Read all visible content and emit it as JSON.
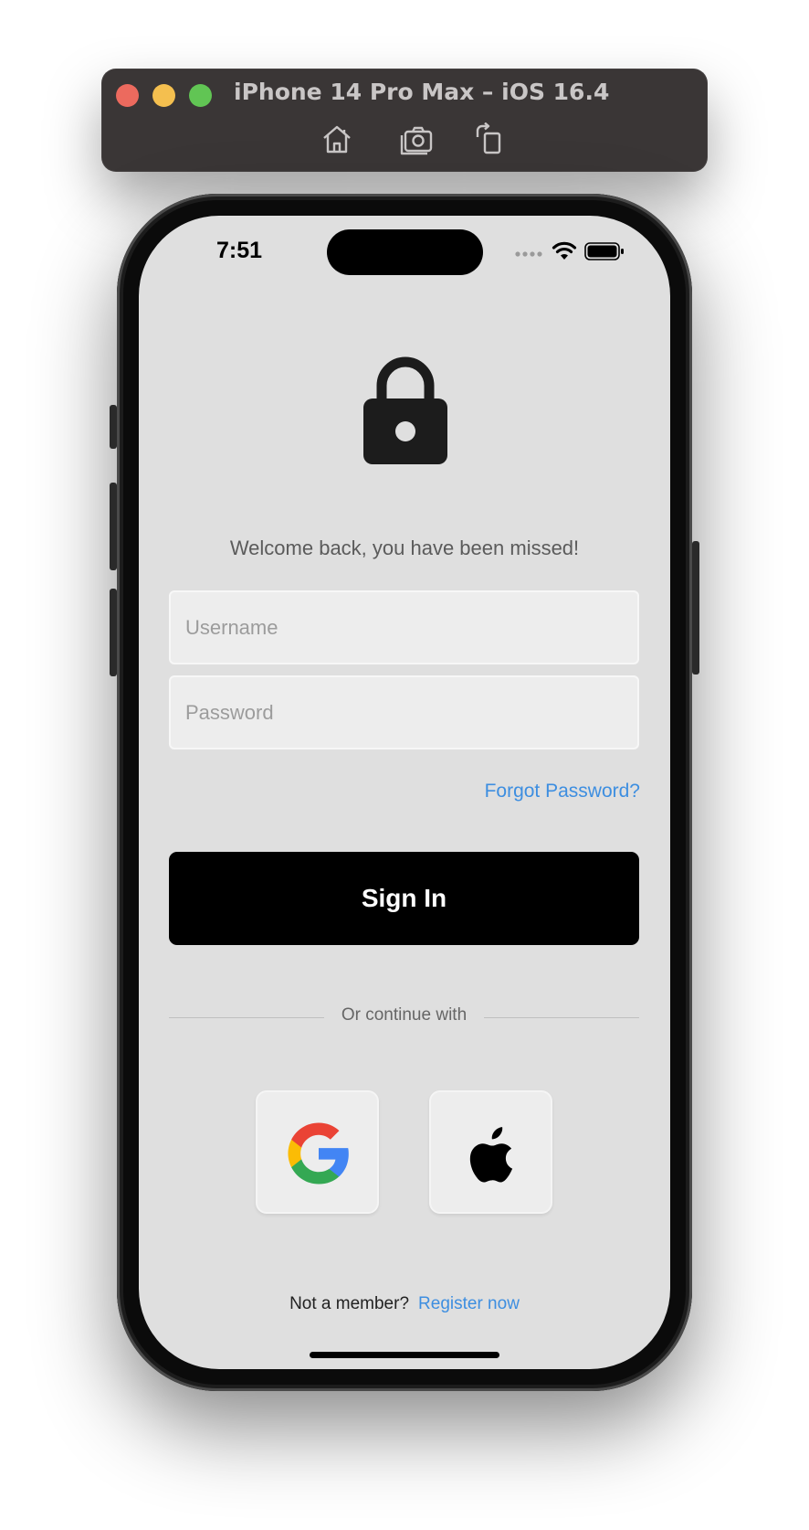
{
  "simulator": {
    "title": "iPhone 14 Pro Max – iOS 16.4",
    "buttons": [
      "home-icon",
      "screenshot-icon",
      "rotate-icon"
    ]
  },
  "status_bar": {
    "time": "7:51",
    "icons": [
      "cellular-signal-icon",
      "wifi-icon",
      "battery-icon"
    ]
  },
  "login": {
    "lock_icon": "lock-icon",
    "welcome_text": "Welcome back, you have been missed!",
    "username_placeholder": "Username",
    "username_value": "",
    "password_placeholder": "Password",
    "password_value": "",
    "forgot_password": "Forgot Password?",
    "sign_in": "Sign In",
    "divider_text": "Or continue with",
    "social": [
      "google-icon",
      "apple-icon"
    ],
    "not_member": "Not a member?",
    "register": "Register now"
  },
  "colors": {
    "screen_bg": "#dfdfdf",
    "link": "#3d8ee0",
    "button_bg": "#000000",
    "field_bg": "#ededed"
  }
}
